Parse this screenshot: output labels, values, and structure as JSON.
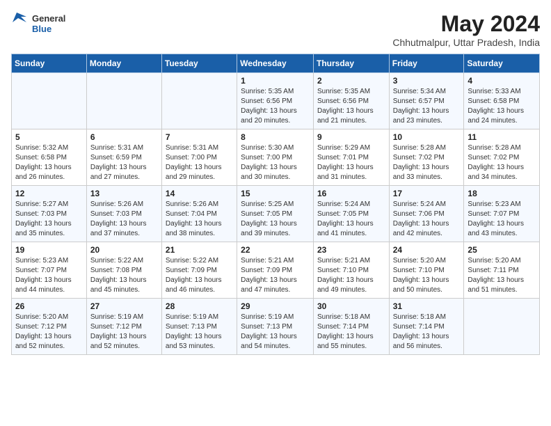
{
  "logo": {
    "general": "General",
    "blue": "Blue"
  },
  "title": {
    "month_year": "May 2024",
    "location": "Chhutmalpur, Uttar Pradesh, India"
  },
  "days_of_week": [
    "Sunday",
    "Monday",
    "Tuesday",
    "Wednesday",
    "Thursday",
    "Friday",
    "Saturday"
  ],
  "weeks": [
    [
      {
        "day": "",
        "sunrise": "",
        "sunset": "",
        "daylight": ""
      },
      {
        "day": "",
        "sunrise": "",
        "sunset": "",
        "daylight": ""
      },
      {
        "day": "",
        "sunrise": "",
        "sunset": "",
        "daylight": ""
      },
      {
        "day": "1",
        "sunrise": "5:35 AM",
        "sunset": "6:56 PM",
        "daylight": "13 hours and 20 minutes."
      },
      {
        "day": "2",
        "sunrise": "5:35 AM",
        "sunset": "6:56 PM",
        "daylight": "13 hours and 21 minutes."
      },
      {
        "day": "3",
        "sunrise": "5:34 AM",
        "sunset": "6:57 PM",
        "daylight": "13 hours and 23 minutes."
      },
      {
        "day": "4",
        "sunrise": "5:33 AM",
        "sunset": "6:58 PM",
        "daylight": "13 hours and 24 minutes."
      }
    ],
    [
      {
        "day": "5",
        "sunrise": "5:32 AM",
        "sunset": "6:58 PM",
        "daylight": "13 hours and 26 minutes."
      },
      {
        "day": "6",
        "sunrise": "5:31 AM",
        "sunset": "6:59 PM",
        "daylight": "13 hours and 27 minutes."
      },
      {
        "day": "7",
        "sunrise": "5:31 AM",
        "sunset": "7:00 PM",
        "daylight": "13 hours and 29 minutes."
      },
      {
        "day": "8",
        "sunrise": "5:30 AM",
        "sunset": "7:00 PM",
        "daylight": "13 hours and 30 minutes."
      },
      {
        "day": "9",
        "sunrise": "5:29 AM",
        "sunset": "7:01 PM",
        "daylight": "13 hours and 31 minutes."
      },
      {
        "day": "10",
        "sunrise": "5:28 AM",
        "sunset": "7:02 PM",
        "daylight": "13 hours and 33 minutes."
      },
      {
        "day": "11",
        "sunrise": "5:28 AM",
        "sunset": "7:02 PM",
        "daylight": "13 hours and 34 minutes."
      }
    ],
    [
      {
        "day": "12",
        "sunrise": "5:27 AM",
        "sunset": "7:03 PM",
        "daylight": "13 hours and 35 minutes."
      },
      {
        "day": "13",
        "sunrise": "5:26 AM",
        "sunset": "7:03 PM",
        "daylight": "13 hours and 37 minutes."
      },
      {
        "day": "14",
        "sunrise": "5:26 AM",
        "sunset": "7:04 PM",
        "daylight": "13 hours and 38 minutes."
      },
      {
        "day": "15",
        "sunrise": "5:25 AM",
        "sunset": "7:05 PM",
        "daylight": "13 hours and 39 minutes."
      },
      {
        "day": "16",
        "sunrise": "5:24 AM",
        "sunset": "7:05 PM",
        "daylight": "13 hours and 41 minutes."
      },
      {
        "day": "17",
        "sunrise": "5:24 AM",
        "sunset": "7:06 PM",
        "daylight": "13 hours and 42 minutes."
      },
      {
        "day": "18",
        "sunrise": "5:23 AM",
        "sunset": "7:07 PM",
        "daylight": "13 hours and 43 minutes."
      }
    ],
    [
      {
        "day": "19",
        "sunrise": "5:23 AM",
        "sunset": "7:07 PM",
        "daylight": "13 hours and 44 minutes."
      },
      {
        "day": "20",
        "sunrise": "5:22 AM",
        "sunset": "7:08 PM",
        "daylight": "13 hours and 45 minutes."
      },
      {
        "day": "21",
        "sunrise": "5:22 AM",
        "sunset": "7:09 PM",
        "daylight": "13 hours and 46 minutes."
      },
      {
        "day": "22",
        "sunrise": "5:21 AM",
        "sunset": "7:09 PM",
        "daylight": "13 hours and 47 minutes."
      },
      {
        "day": "23",
        "sunrise": "5:21 AM",
        "sunset": "7:10 PM",
        "daylight": "13 hours and 49 minutes."
      },
      {
        "day": "24",
        "sunrise": "5:20 AM",
        "sunset": "7:10 PM",
        "daylight": "13 hours and 50 minutes."
      },
      {
        "day": "25",
        "sunrise": "5:20 AM",
        "sunset": "7:11 PM",
        "daylight": "13 hours and 51 minutes."
      }
    ],
    [
      {
        "day": "26",
        "sunrise": "5:20 AM",
        "sunset": "7:12 PM",
        "daylight": "13 hours and 52 minutes."
      },
      {
        "day": "27",
        "sunrise": "5:19 AM",
        "sunset": "7:12 PM",
        "daylight": "13 hours and 52 minutes."
      },
      {
        "day": "28",
        "sunrise": "5:19 AM",
        "sunset": "7:13 PM",
        "daylight": "13 hours and 53 minutes."
      },
      {
        "day": "29",
        "sunrise": "5:19 AM",
        "sunset": "7:13 PM",
        "daylight": "13 hours and 54 minutes."
      },
      {
        "day": "30",
        "sunrise": "5:18 AM",
        "sunset": "7:14 PM",
        "daylight": "13 hours and 55 minutes."
      },
      {
        "day": "31",
        "sunrise": "5:18 AM",
        "sunset": "7:14 PM",
        "daylight": "13 hours and 56 minutes."
      },
      {
        "day": "",
        "sunrise": "",
        "sunset": "",
        "daylight": ""
      }
    ]
  ],
  "labels": {
    "sunrise_prefix": "Sunrise: ",
    "sunset_prefix": "Sunset: ",
    "daylight_prefix": "Daylight: "
  }
}
